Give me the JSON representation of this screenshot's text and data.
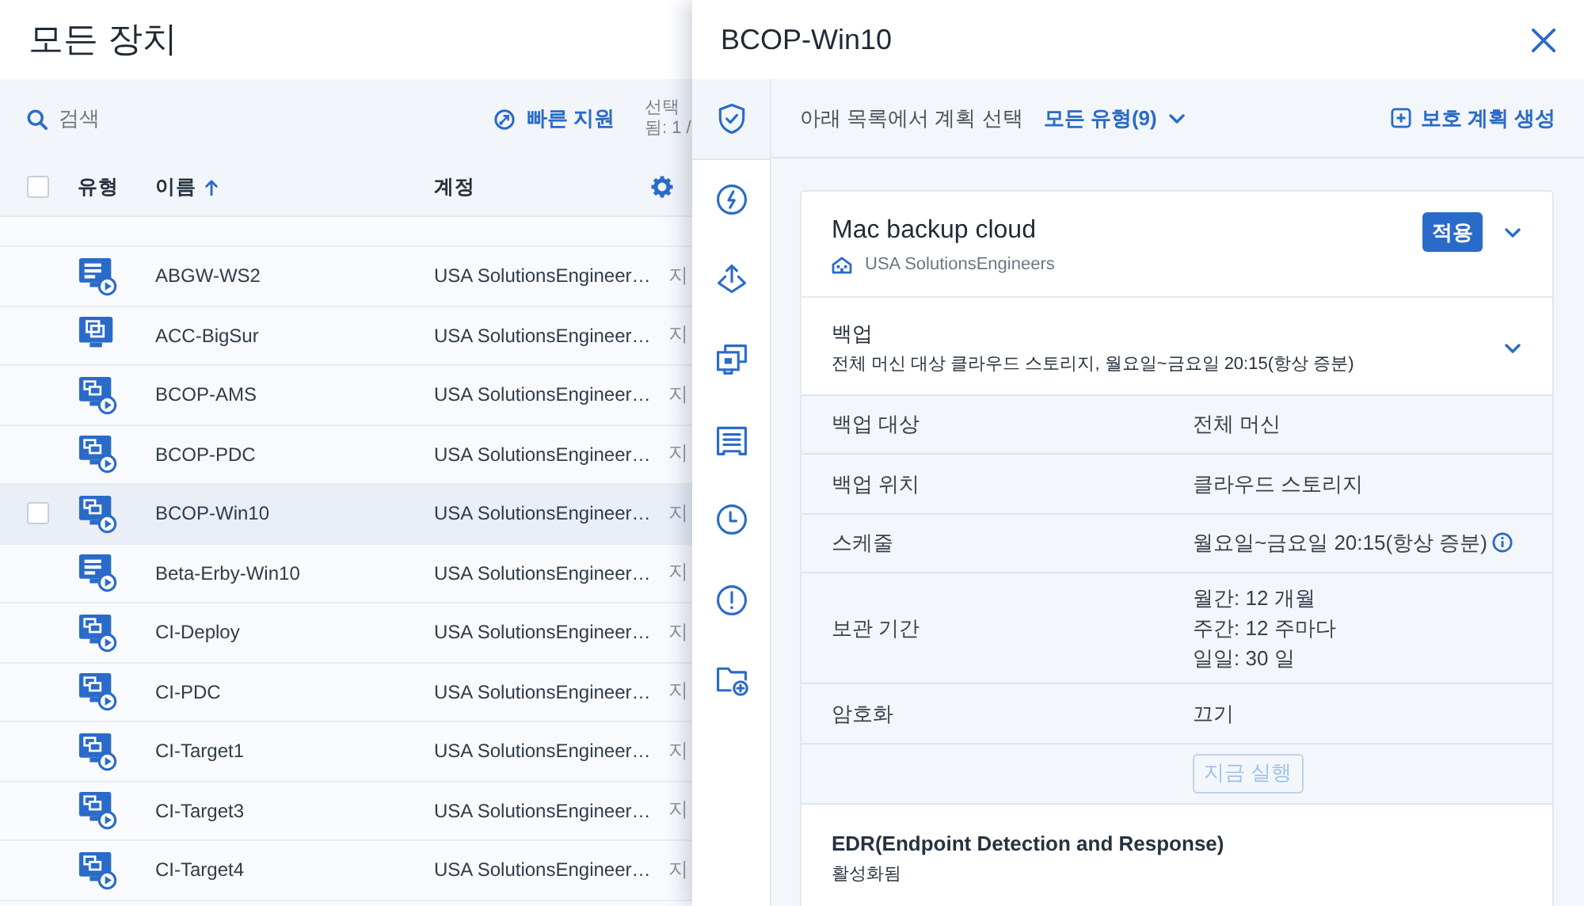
{
  "devices_panel": {
    "title": "모든 장치",
    "search": {
      "placeholder": "검색"
    },
    "quick_assist": "빠른 지원",
    "selection_info": "선택 됨: 1 /",
    "table": {
      "select_all": {
        "checked": false
      },
      "columns": [
        {
          "label": "유형",
          "sorted": false
        },
        {
          "label": "이름",
          "sorted": true
        },
        {
          "label": "계정",
          "sorted": false
        }
      ],
      "rows": [
        {
          "kind": "hc",
          "name": "ABGW-WS2",
          "account": "USA SolutionsEngineer…",
          "column_4": "지",
          "selected": false
        },
        {
          "kind": "workstation",
          "name": "ACC-BigSur",
          "account": "USA SolutionsEngineer…",
          "column_4": "지",
          "selected": false
        },
        {
          "kind": "vm",
          "name": "BCOP-AMS",
          "account": "USA SolutionsEngineer…",
          "column_4": "지",
          "selected": false
        },
        {
          "kind": "vm",
          "name": "BCOP-PDC",
          "account": "USA SolutionsEngineer…",
          "column_4": "지",
          "selected": false
        },
        {
          "kind": "vm",
          "name": "BCOP-Win10",
          "account": "USA SolutionsEngineer…",
          "column_4": "지",
          "selected": true
        },
        {
          "kind": "hc",
          "name": "Beta-Erby-Win10",
          "account": "USA SolutionsEngineer…",
          "column_4": "지",
          "selected": false
        },
        {
          "kind": "vm",
          "name": "CI-Deploy",
          "account": "USA SolutionsEngineer…",
          "column_4": "지",
          "selected": false
        },
        {
          "kind": "vm",
          "name": "CI-PDC",
          "account": "USA SolutionsEngineer…",
          "column_4": "지",
          "selected": false
        },
        {
          "kind": "vm",
          "name": "CI-Target1",
          "account": "USA SolutionsEngineer…",
          "column_4": "지",
          "selected": false
        },
        {
          "kind": "vm",
          "name": "CI-Target3",
          "account": "USA SolutionsEngineer…",
          "column_4": "지",
          "selected": false
        },
        {
          "kind": "vm",
          "name": "CI-Target4",
          "account": "USA SolutionsEngineer…",
          "column_4": "지",
          "selected": false
        }
      ]
    }
  },
  "plan_panel": {
    "title": "BCOP-Win10",
    "side_tabs": [
      {
        "kind": "shield",
        "selected": true
      },
      {
        "kind": "bolt",
        "selected": false
      },
      {
        "kind": "upload",
        "selected": false
      },
      {
        "kind": "windows",
        "selected": false
      },
      {
        "kind": "document",
        "selected": false
      },
      {
        "kind": "clock",
        "selected": false
      },
      {
        "kind": "alert",
        "selected": false
      },
      {
        "kind": "folder_plus",
        "selected": false
      }
    ],
    "toolbar": {
      "prompt": "아래 목록에서 계획 선택",
      "filter": "모든 유형(9)",
      "create_button": "보호 계획 생성"
    },
    "plan": {
      "name": "Mac backup cloud",
      "apply_button": "적용",
      "owner": "USA SolutionsEngineers",
      "sections": [
        {
          "kind": "backup",
          "title": "백업",
          "summary": "전체 머신 대상 클라우드 스토리지, 월요일~금요일 20:15(항상 증분)",
          "details": [
            {
              "label": "백업 대상",
              "lines": [
                "전체 머신"
              ],
              "info": false
            },
            {
              "label": "백업 위치",
              "lines": [
                "클라우드 스토리지"
              ],
              "info": false
            },
            {
              "label": "스케줄",
              "lines": [
                "월요일~금요일 20:15(항상 증분)"
              ],
              "info": true
            },
            {
              "label": "보관 기간",
              "lines": [
                "월간: 12 개월",
                "주간: 12 주마다",
                "일일: 30 일"
              ],
              "info": false
            },
            {
              "label": "암호화",
              "lines": [
                "끄기"
              ],
              "info": false
            }
          ],
          "run_now": {
            "label": "지금 실행",
            "disabled": true
          }
        },
        {
          "kind": "edr",
          "title": "EDR(Endpoint Detection and Response)",
          "summary": "활성화됨"
        }
      ]
    }
  }
}
